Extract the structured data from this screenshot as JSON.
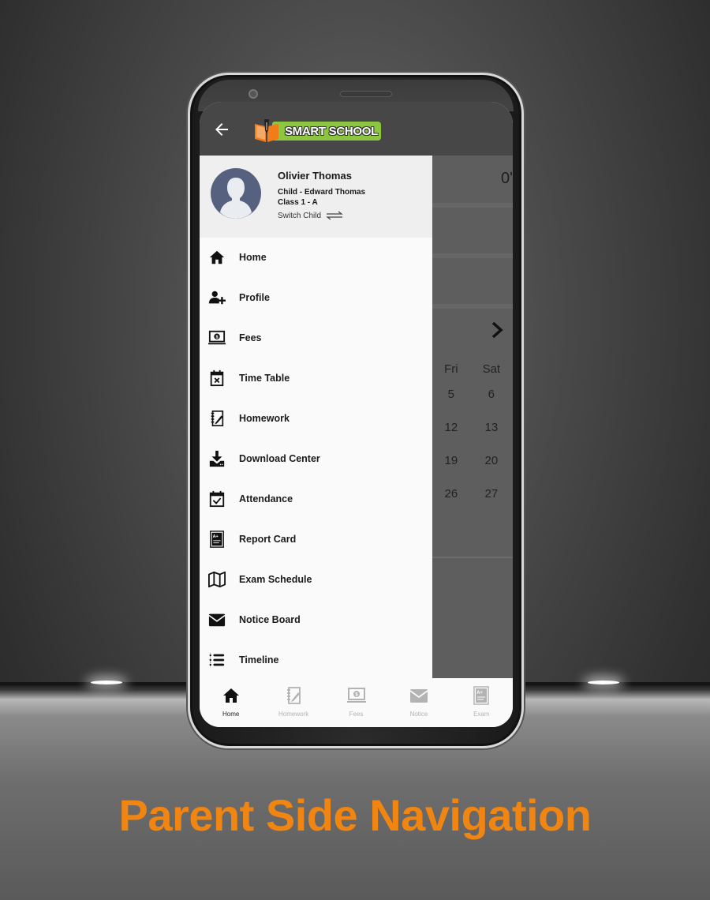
{
  "app": {
    "logo_text": "SMART SCHOOL",
    "colors": {
      "appbar": "#474747",
      "logo_green": "#8cc63f",
      "logo_orange": "#f07c1a",
      "headline": "#f08512"
    }
  },
  "drawer": {
    "user_name": "Olivier Thomas",
    "child_line": "Child - Edward Thomas",
    "class_line": "Class 1 - A",
    "switch_child_label": "Switch Child",
    "items": [
      {
        "label": "Home",
        "icon": "home-icon"
      },
      {
        "label": "Profile",
        "icon": "user-plus-icon"
      },
      {
        "label": "Fees",
        "icon": "fees-laptop-icon"
      },
      {
        "label": "Time Table",
        "icon": "calendar-x-icon"
      },
      {
        "label": "Homework",
        "icon": "notebook-pen-icon"
      },
      {
        "label": "Download Center",
        "icon": "download-icon"
      },
      {
        "label": "Attendance",
        "icon": "calendar-check-icon"
      },
      {
        "label": "Report Card",
        "icon": "report-card-icon"
      },
      {
        "label": "Exam Schedule",
        "icon": "map-icon"
      },
      {
        "label": "Notice Board",
        "icon": "envelope-icon"
      },
      {
        "label": "Timeline",
        "icon": "list-icon"
      }
    ]
  },
  "background_screen": {
    "top_value": "0'",
    "calendar": {
      "headers": [
        "Fri",
        "Sat"
      ],
      "rows": [
        [
          "5",
          "6"
        ],
        [
          "12",
          "13"
        ],
        [
          "19",
          "20"
        ],
        [
          "26",
          "27"
        ]
      ]
    }
  },
  "bottom_nav": {
    "items": [
      {
        "label": "Home",
        "icon": "home-icon",
        "active": true
      },
      {
        "label": "Homework",
        "icon": "notebook-pen-icon",
        "active": false
      },
      {
        "label": "Fees",
        "icon": "fees-laptop-icon",
        "active": false
      },
      {
        "label": "Notice",
        "icon": "envelope-icon",
        "active": false
      },
      {
        "label": "Exam",
        "icon": "report-card-icon",
        "active": false
      }
    ]
  },
  "headline": "Parent Side Navigation"
}
